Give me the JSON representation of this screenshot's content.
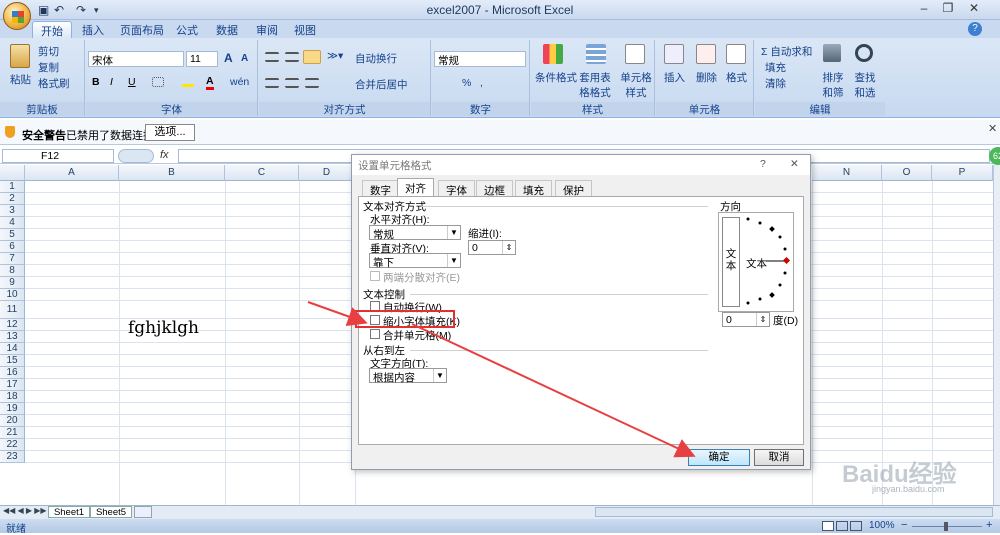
{
  "titlebar": {
    "title": "excel2007 - Microsoft Excel",
    "help": "?"
  },
  "ribbon_tabs": [
    "开始",
    "插入",
    "页面布局",
    "公式",
    "数据",
    "审阅",
    "视图"
  ],
  "clipboard": {
    "paste": "粘贴",
    "cut": "剪切",
    "copy": "复制",
    "format_painter": "格式刷",
    "label": "剪贴板"
  },
  "font": {
    "name": "宋体",
    "size": "11",
    "grow": "A",
    "shrink": "A",
    "bold": "B",
    "italic": "I",
    "underline": "U",
    "color_a": "A",
    "phonetic": "wén",
    "label": "字体"
  },
  "alignment": {
    "wrap": "自动换行",
    "merge": "合并后居中",
    "label": "对齐方式"
  },
  "number": {
    "format": "常规",
    "percent": "%",
    "comma": ",",
    "label": "数字"
  },
  "styles": {
    "cond": "条件格式",
    "table": "套用表格格式",
    "cell": "单元格样式",
    "label": "样式"
  },
  "cells": {
    "insert": "插入",
    "delete": "删除",
    "format": "格式",
    "label": "单元格"
  },
  "editing": {
    "autosum": "Σ 自动求和",
    "fill": "填充",
    "clear": "清除",
    "sort": "排序和筛选",
    "find": "查找和选择",
    "label": "编辑"
  },
  "security": {
    "title": "安全警告",
    "message": "已禁用了数据连接",
    "options": "选项..."
  },
  "formula_bar": {
    "name_box": "F12",
    "fx": "fx",
    "value": ""
  },
  "columns": [
    "A",
    "B",
    "C",
    "D",
    "N",
    "O",
    "P"
  ],
  "rows": [
    "1",
    "2",
    "3",
    "4",
    "5",
    "6",
    "7",
    "8",
    "9",
    "10",
    "11",
    "12",
    "13",
    "14",
    "15",
    "16",
    "17",
    "18",
    "19",
    "20",
    "21",
    "22",
    "23"
  ],
  "cell_text": "fghjklgh",
  "sheets": [
    "Sheet1",
    "Sheet5"
  ],
  "status": {
    "ready": "就绪",
    "zoom": "100%",
    "minus": "−",
    "plus": "+"
  },
  "badge": "62",
  "dialog": {
    "title": "设置单元格格式",
    "help": "?",
    "close": "✕",
    "tabs": [
      "数字",
      "对齐",
      "字体",
      "边框",
      "填充",
      "保护"
    ],
    "text_align_section": "文本对齐方式",
    "h_align_label": "水平对齐(H):",
    "h_align_value": "常规",
    "indent_label": "缩进(I):",
    "indent_value": "0",
    "v_align_label": "垂直对齐(V):",
    "v_align_value": "靠下",
    "justify_distributed": "两端分散对齐(E)",
    "text_control_section": "文本控制",
    "wrap_text": "自动换行(W)",
    "shrink_to_fit": "缩小字体填充(K)",
    "merge_cells": "合并单元格(M)",
    "rtl_section": "从右到左",
    "text_direction_label": "文字方向(T):",
    "text_direction_value": "根据内容",
    "orientation_section": "方向",
    "vertical_text": "文本",
    "horizontal_text": "文本",
    "degree_value": "0",
    "degree_label": "度(D)",
    "ok": "确定",
    "cancel": "取消"
  },
  "watermark": {
    "brand": "Baidu经验",
    "url": "jingyan.baidu.com"
  },
  "colors": {
    "highlight": "#e03030",
    "arrow": "#e84040"
  }
}
